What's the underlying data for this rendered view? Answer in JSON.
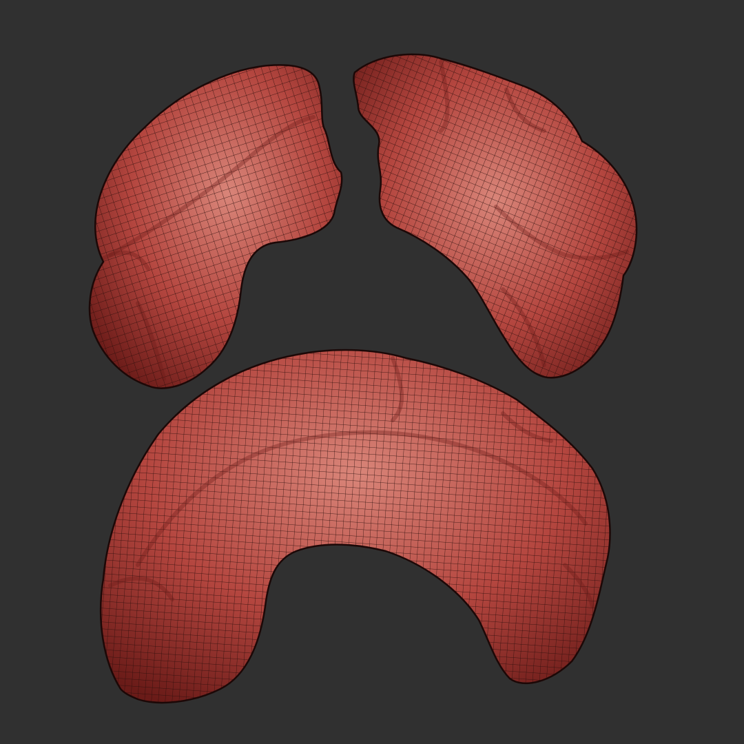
{
  "viewport": {
    "background_color": "#303030",
    "description_visible_text": ""
  },
  "colors": {
    "mesh_base": "#b4463f",
    "mesh_highlight": "#d98579",
    "mesh_shadow": "#6a1b18",
    "wire": "#2a0d0b",
    "outline": "#1c0807"
  },
  "objects": [
    {
      "id": "left-half-piece"
    },
    {
      "id": "right-half-piece"
    },
    {
      "id": "combined-arch-piece"
    }
  ]
}
